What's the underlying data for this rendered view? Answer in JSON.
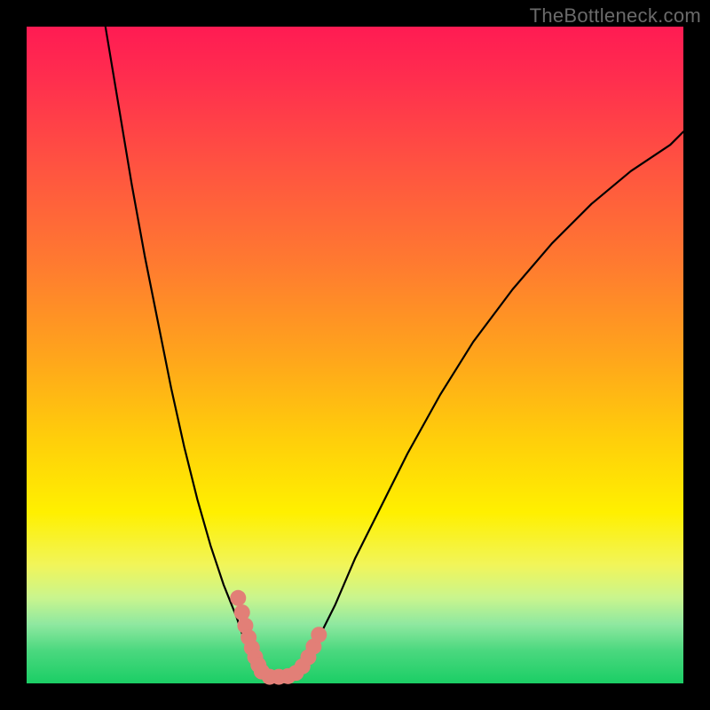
{
  "watermark": "TheBottleneck.com",
  "chart_data": {
    "type": "line",
    "title": "",
    "xlabel": "",
    "ylabel": "",
    "xlim": [
      0,
      100
    ],
    "ylim": [
      0,
      100
    ],
    "series": [
      {
        "name": "left-curve",
        "x": [
          12,
          14,
          16,
          18,
          20,
          22,
          24,
          26,
          28,
          30,
          32,
          33,
          34,
          35,
          35.5
        ],
        "y": [
          100,
          88,
          76,
          65,
          55,
          45,
          36,
          28,
          21,
          15,
          10,
          7,
          5,
          3,
          2
        ]
      },
      {
        "name": "right-curve",
        "x": [
          42,
          44,
          47,
          50,
          54,
          58,
          63,
          68,
          74,
          80,
          86,
          92,
          98,
          100
        ],
        "y": [
          2,
          6,
          12,
          19,
          27,
          35,
          44,
          52,
          60,
          67,
          73,
          78,
          82,
          84
        ]
      },
      {
        "name": "valley-floor",
        "x": [
          35.5,
          36.5,
          38,
          40,
          42
        ],
        "y": [
          2,
          1.2,
          1,
          1.2,
          2
        ]
      }
    ],
    "markers": [
      {
        "name": "left-marker-cluster",
        "color": "#e27f77",
        "points": [
          {
            "x": 32.2,
            "y": 13.0
          },
          {
            "x": 32.8,
            "y": 10.8
          },
          {
            "x": 33.3,
            "y": 8.8
          },
          {
            "x": 33.8,
            "y": 7.0
          },
          {
            "x": 34.3,
            "y": 5.4
          },
          {
            "x": 34.8,
            "y": 4.0
          },
          {
            "x": 35.3,
            "y": 2.8
          },
          {
            "x": 35.8,
            "y": 1.8
          }
        ]
      },
      {
        "name": "right-marker-cluster",
        "color": "#e27f77",
        "points": [
          {
            "x": 37.0,
            "y": 1.0
          },
          {
            "x": 38.4,
            "y": 1.0
          },
          {
            "x": 39.8,
            "y": 1.1
          },
          {
            "x": 41.0,
            "y": 1.6
          },
          {
            "x": 42.0,
            "y": 2.6
          },
          {
            "x": 42.9,
            "y": 4.0
          },
          {
            "x": 43.7,
            "y": 5.6
          },
          {
            "x": 44.5,
            "y": 7.4
          }
        ]
      }
    ],
    "background_gradient": {
      "top": "#ff1b53",
      "mid": "#fff000",
      "bottom": "#1bce65"
    }
  },
  "style": {
    "curve_stroke": "#000000",
    "curve_width": 2.2,
    "marker_radius": 9,
    "marker_fill": "#e27f77"
  }
}
